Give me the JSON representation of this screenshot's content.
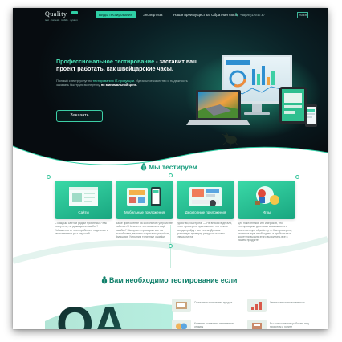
{
  "nav": {
    "logo": {
      "word": "Quality",
      "tagline": "test · contest · mobile · system"
    },
    "items": [
      {
        "label": "Виды тестирования",
        "active": true
      },
      {
        "label": "Экспертиза",
        "active": false
      },
      {
        "label": "Наши преимущества",
        "active": false
      },
      {
        "label": "Обратная связь",
        "active": false
      }
    ],
    "phone": "+38(095)129-67-67",
    "lang": "Ru En"
  },
  "hero": {
    "title_accent": "Профессиональное тестирование",
    "title_rest": " - заставит ваш проект работать, как швейцарские часы.",
    "desc_prefix": "Полный спектр услуг по ",
    "desc_link": "тестированию IT-продукции",
    "desc_middle": ". Идеальное качество и надежность заказать быструю экспертизу ",
    "desc_strong": "по минимальной цене.",
    "order_button": "Заказать"
  },
  "we_test": {
    "title": "Мы тестируем",
    "cards": [
      {
        "label": "Сайты",
        "text": "С каждым сайтом рядом проблемы!? Как поступить, не дожидаясь ошибок? Избавьтесь от этих проблем в надежные и качественные ру-к улучшай."
      },
      {
        "label": "Мобильные приложения",
        "text": "Ваше приложение на мобильном устройстве работает! Нельзя ли что выяснить ещё ошибки? Мы просто проверим все на устройствах, версиях и ярлыках устройств, функциях. Устраним типичные ошибки."
      },
      {
        "label": "Десктопные приложения",
        "text": "Удобство, быстрота, — Не вникая в детали, стоит проверить приложение, это нужно всегда пройдут все тесты. Делаем грамотную проверку ресурсов нашего специалиста."
      },
      {
        "label": "Игры",
        "text": "Для поклонников игр и игроков, что тестировщики дают вам возможность и качественную обработку — Как проверить, что ваша игра необходима и прибыльна и может ли вы для этого выполнить все в нашем продукте."
      }
    ]
  },
  "need_testing": {
    "title": "Вам необходимо тестирование если",
    "qa_text": "QA",
    "reasons": [
      {
        "text": "Снижается количество продаж"
      },
      {
        "text": "Уменьшается посещаемость"
      },
      {
        "text": "Клиенты оставляют негативные отзывы"
      },
      {
        "text": "Вы только начали работать над проектом и хотите"
      }
    ]
  },
  "colors": {
    "accent": "#2fcfa5",
    "accent_dark": "#1a9e7f",
    "hero_bg": "#0a1f24",
    "card_green": "#19a680"
  }
}
